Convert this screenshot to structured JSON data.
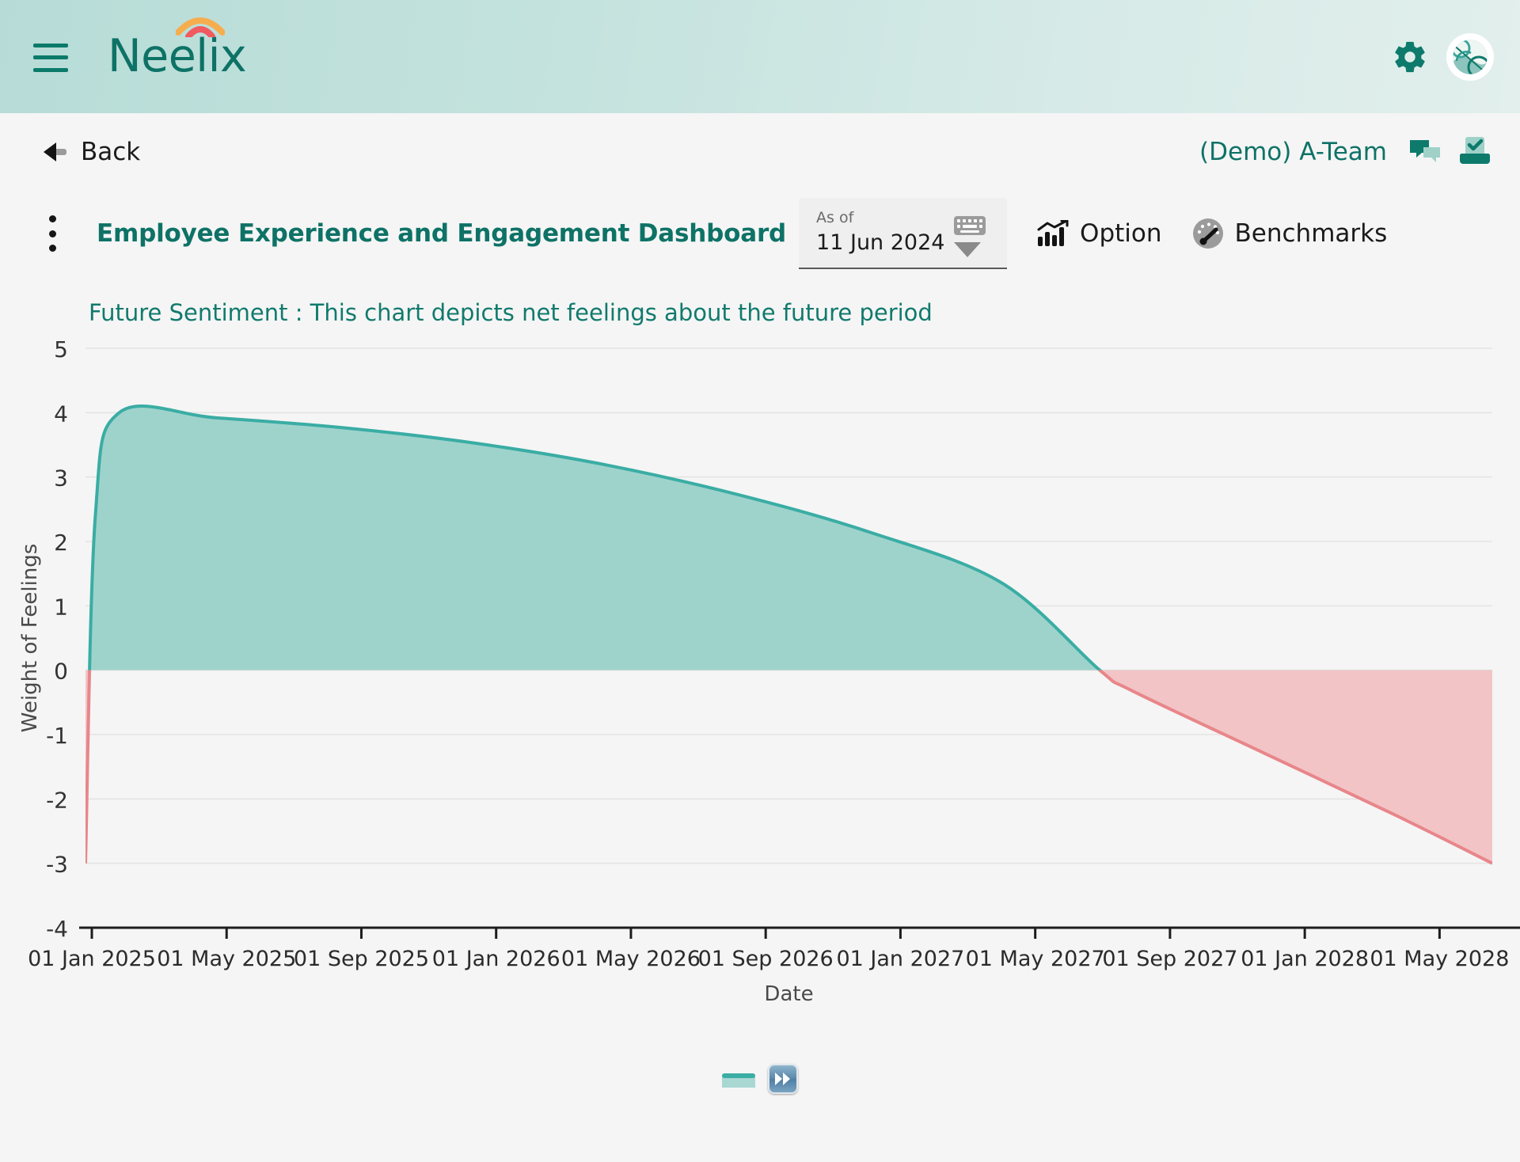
{
  "header": {
    "menu_icon": "hamburger-menu-icon",
    "brand": "Neelix",
    "settings_icon": "gear-icon",
    "avatar_icon": "user-avatar"
  },
  "backbar": {
    "back_label": "Back",
    "team_label": "(Demo) A-Team",
    "chat_icon": "chat-bubbles-icon",
    "inbox_icon": "inbox-check-icon"
  },
  "toolbar": {
    "more_icon": "kebab-menu-icon",
    "dashboard_title": "Employee Experience and Engagement Dashboard",
    "date_picker": {
      "label": "As of",
      "value": "11 Jun 2024",
      "keyboard_icon": "keyboard-icon",
      "caret_icon": "chevron-down-icon"
    },
    "option_label": "Option",
    "option_icon": "chart-bars-icon",
    "benchmarks_label": "Benchmarks",
    "benchmarks_icon": "gauge-icon"
  },
  "colors": {
    "brand_teal": "#0e7266",
    "positive_line": "#3aada4",
    "positive_fill": "#9ed3cc",
    "negative_line": "#e8868a",
    "negative_fill": "#f2c4c6",
    "header_gradient_start": "#b7dcd7",
    "header_gradient_end": "#e2efec",
    "page_bg": "#f5f5f5"
  },
  "legend": {
    "series_swatch": "future-sentiment-series",
    "fast_forward_icon": "fast-forward-icon"
  },
  "chart_data": {
    "type": "area",
    "title": "Future Sentiment : This chart depicts net feelings about the future period",
    "xlabel": "Date",
    "ylabel": "Weight of Feelings",
    "ylim": [
      -4,
      5
    ],
    "yticks": [
      5,
      4,
      3,
      2,
      1,
      0,
      -1,
      -2,
      -3,
      -4
    ],
    "xticks": [
      "01 Jan 2025",
      "01 May 2025",
      "01 Sep 2025",
      "01 Jan 2026",
      "01 May 2026",
      "01 Sep 2026",
      "01 Jan 2027",
      "01 May 2027",
      "01 Sep 2027",
      "01 Jan 2028",
      "01 May 2028"
    ],
    "grid": true,
    "legend_position": "bottom",
    "zero_baseline": 0,
    "zero_crossing_x": "01 Aug 2027",
    "series": [
      {
        "name": "Future Sentiment",
        "x": [
          "01 Jan 2025",
          "10 Jan 2025",
          "01 Feb 2025",
          "01 May 2025",
          "01 Sep 2025",
          "01 Jan 2026",
          "01 May 2026",
          "01 Sep 2026",
          "01 Jan 2027",
          "01 May 2027",
          "01 Aug 2027",
          "01 Sep 2027",
          "01 Jan 2028",
          "01 May 2028",
          "01 Aug 2028"
        ],
        "values": [
          -3.0,
          2.4,
          4.0,
          3.92,
          3.76,
          3.52,
          3.18,
          2.72,
          2.14,
          1.36,
          0.0,
          -0.32,
          -1.28,
          -2.24,
          -3.0
        ]
      }
    ]
  }
}
